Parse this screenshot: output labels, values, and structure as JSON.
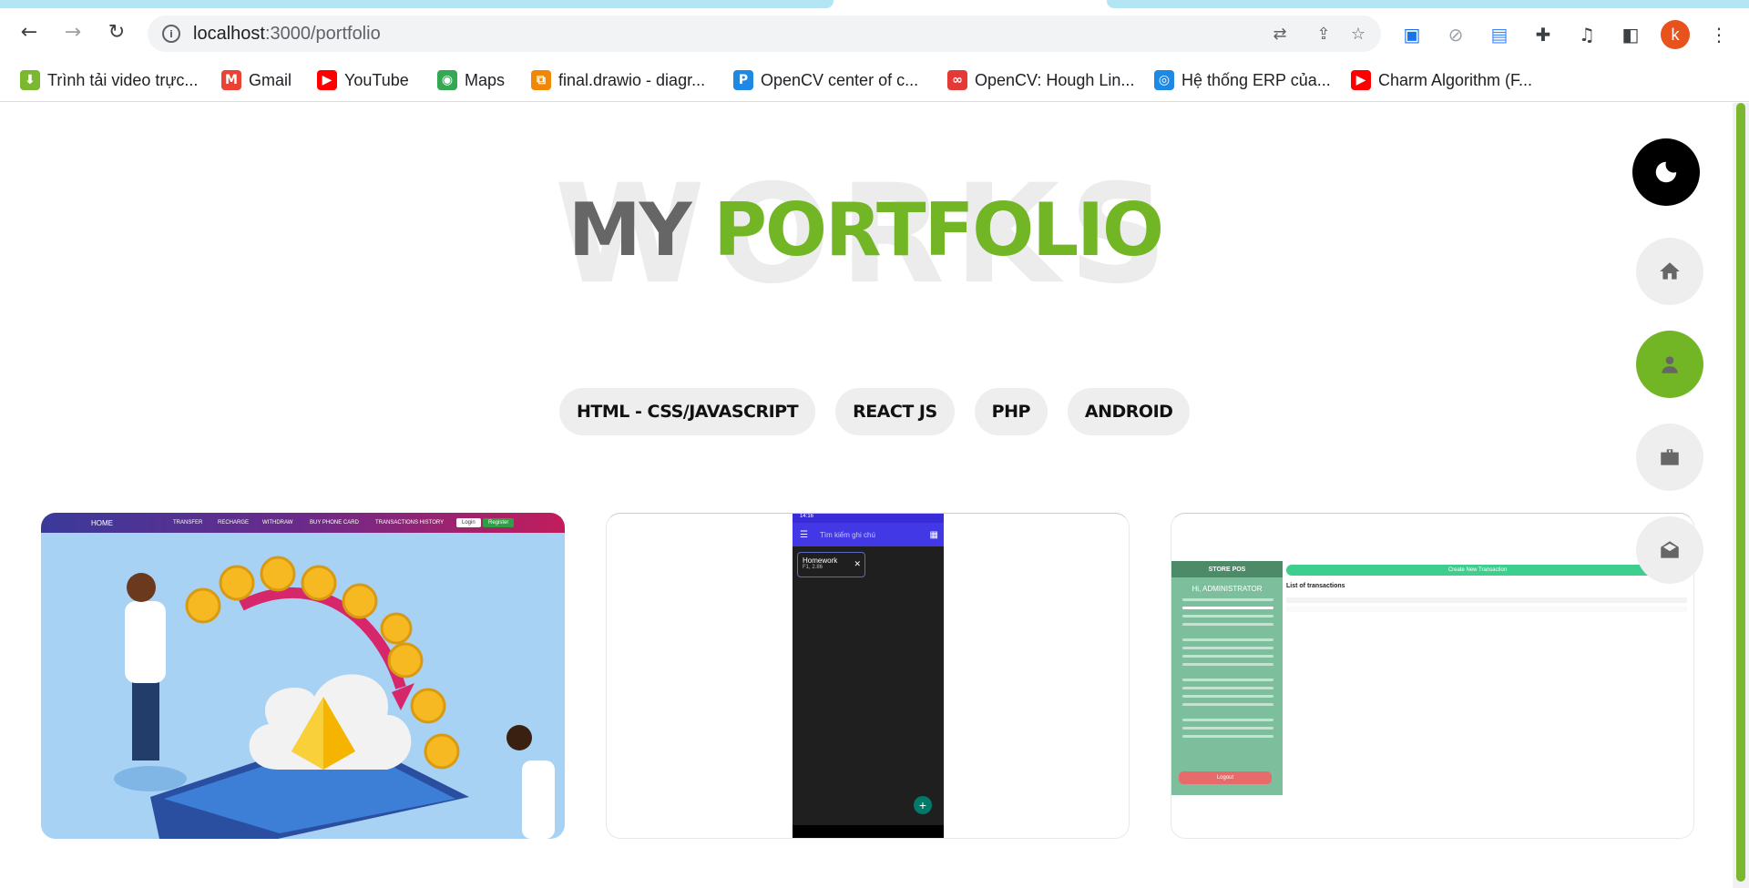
{
  "browser": {
    "url_host": "localhost",
    "url_path": ":3000/portfolio",
    "profile_initial": "k",
    "bookmarks": [
      {
        "label": "Trình tải video trực...",
        "icon": "download-arrow-icon",
        "color": "#7cb82f"
      },
      {
        "label": "Gmail",
        "icon": "gmail-icon",
        "color": "#ea4335"
      },
      {
        "label": "YouTube",
        "icon": "youtube-icon",
        "color": "#ff0000"
      },
      {
        "label": "Maps",
        "icon": "maps-pin-icon",
        "color": "#34a853"
      },
      {
        "label": "final.drawio - diagr...",
        "icon": "drawio-icon",
        "color": "#f08705"
      },
      {
        "label": "OpenCV center of c...",
        "icon": "pyimagesearch-icon",
        "color": "#1e88e5"
      },
      {
        "label": "OpenCV: Hough Lin...",
        "icon": "opencv-icon",
        "color": "#e53935"
      },
      {
        "label": "Hệ thống ERP của...",
        "icon": "erp-icon",
        "color": "#1e88e5"
      },
      {
        "label": "Charm Algorithm (F...",
        "icon": "youtube-icon",
        "color": "#ff0000"
      }
    ]
  },
  "hero": {
    "background_word": "WORKS",
    "title_first": "MY",
    "title_second": "PORTFOLIO"
  },
  "filters": [
    "HTML - CSS/JAVASCRIPT",
    "REACT JS",
    "PHP",
    "ANDROID"
  ],
  "cards": {
    "card1": {
      "nav": {
        "home": "HOME",
        "transfer": "TRANSFER",
        "recharge": "RECHARGE",
        "withdraw": "WITHDRAW",
        "buy": "BUY PHONE CARD",
        "history": "TRANSACTIONS HISTORY",
        "login": "Login",
        "register": "Register"
      }
    },
    "card2": {
      "search_placeholder": "Tìm kiếm ghi chú",
      "note_title": "Homework",
      "note_sub": "F1, 2.86"
    },
    "card3": {
      "brand": "STORE POS",
      "greeting": "Hi, ADMINISTRATOR",
      "create": "Create New Transaction",
      "list_title": "List of transactions",
      "logout": "Logout"
    }
  },
  "side_nav": [
    "theme-toggle",
    "home",
    "about",
    "portfolio",
    "contact"
  ],
  "colors": {
    "accent": "#72b626",
    "title_gray": "#666666",
    "button_bg": "#eeeeee"
  }
}
